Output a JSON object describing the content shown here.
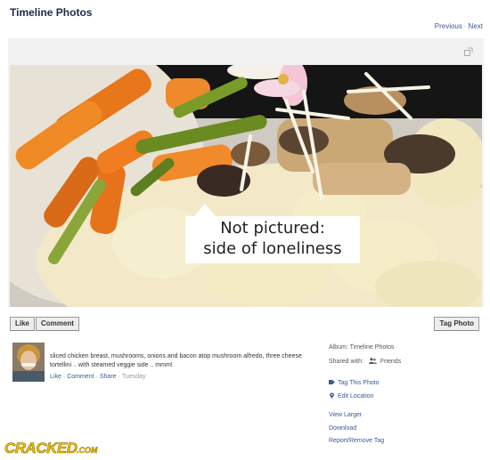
{
  "page": {
    "title": "Timeline Photos"
  },
  "pager": {
    "previous": "Previous",
    "separator": "·",
    "next": "Next"
  },
  "photo": {
    "caption_overlay": {
      "line1": "Not pictured:",
      "line2": "side of loneliness"
    }
  },
  "actions": {
    "like": "Like",
    "comment": "Comment",
    "tag_photo": "Tag Photo"
  },
  "post": {
    "caption": "sliced chicken breast, mushrooms, onions and bacon atop mushroom alfredo, three cheese tortellini .. with steamed veggie side .. mmm!",
    "like": "Like",
    "comment": "Comment",
    "share": "Share",
    "separator": "·",
    "timestamp": "Tuesday"
  },
  "meta": {
    "album_label": "Album:",
    "album_value": "Timeline Photos",
    "shared_label": "Shared with:",
    "shared_value": "Friends"
  },
  "sidebar_links": {
    "tag_this_photo": "Tag This Photo",
    "edit_location": "Edit Location",
    "view_larger": "View Larger",
    "download": "Download",
    "report_remove_tag": "Report/Remove Tag"
  },
  "watermark": {
    "text": "CRACKED.COM"
  },
  "colors": {
    "link": "#3b5998",
    "title": "#1c2a47",
    "watermark": "#f2c200"
  },
  "icons": [
    "expand-icon",
    "friends-icon",
    "tag-icon",
    "location-pin-icon"
  ]
}
